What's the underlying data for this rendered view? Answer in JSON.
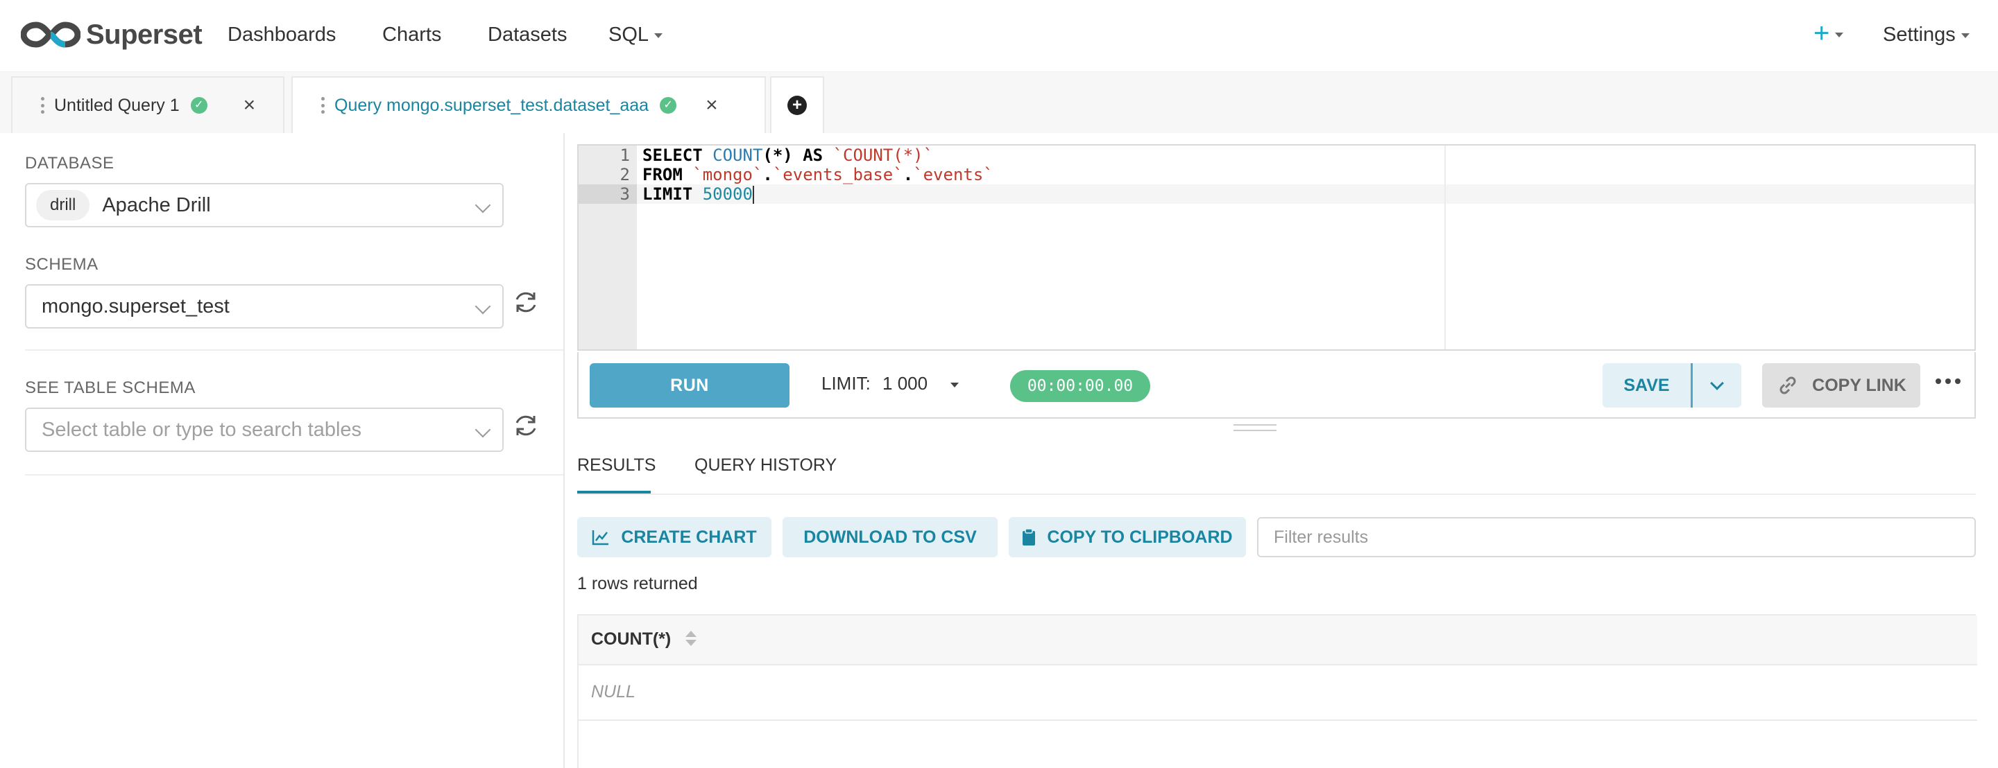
{
  "navbar": {
    "brand": "Superset",
    "items": [
      "Dashboards",
      "Charts",
      "Datasets",
      "SQL"
    ],
    "plus": "+",
    "settings": "Settings"
  },
  "query_tabs": [
    {
      "title": "Untitled Query 1",
      "active": false
    },
    {
      "title": "Query mongo.superset_test.dataset_aaa",
      "active": true
    }
  ],
  "left": {
    "database_label": "DATABASE",
    "database_chip": "drill",
    "database_value": "Apache Drill",
    "schema_label": "SCHEMA",
    "schema_value": "mongo.superset_test",
    "table_schema_label": "SEE TABLE SCHEMA",
    "table_placeholder": "Select table or type to search tables"
  },
  "editor": {
    "line_numbers": [
      "1",
      "2",
      "3"
    ],
    "lines": [
      [
        [
          "kw",
          "SELECT "
        ],
        [
          "fn",
          "COUNT"
        ],
        [
          "kw",
          "(*) AS "
        ],
        [
          "str",
          "`COUNT(*)`"
        ]
      ],
      [
        [
          "kw",
          "FROM "
        ],
        [
          "str",
          "`mongo`"
        ],
        [
          "kw",
          "."
        ],
        [
          "str",
          "`events_base`"
        ],
        [
          "kw",
          "."
        ],
        [
          "str",
          "`events`"
        ]
      ],
      [
        [
          "kw",
          "LIMIT "
        ],
        [
          "num",
          "50000"
        ]
      ]
    ]
  },
  "toolbar": {
    "run": "RUN",
    "limit_label": "LIMIT:",
    "limit_value": "1 000",
    "timer": "00:00:00.00",
    "save": "SAVE",
    "copy_link": "COPY LINK"
  },
  "results": {
    "tab_results": "RESULTS",
    "tab_history": "QUERY HISTORY",
    "create_chart": "CREATE CHART",
    "download_csv": "DOWNLOAD TO CSV",
    "copy_clipboard": "COPY TO CLIPBOARD",
    "filter_placeholder": "Filter results",
    "rows_returned": "1 rows returned",
    "columns": [
      "COUNT(*)"
    ],
    "rows": [
      [
        "NULL"
      ]
    ]
  },
  "colors": {
    "accent": "#1a85a0",
    "run": "#4fa6c7",
    "success": "#5ac189"
  }
}
